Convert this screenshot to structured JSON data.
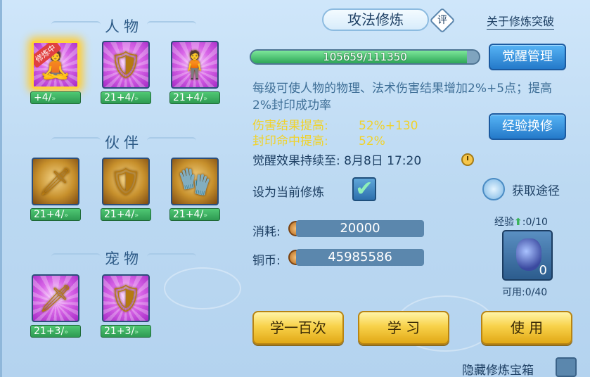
{
  "left": {
    "sections": [
      {
        "title": "人物"
      },
      {
        "title": "伙伴"
      },
      {
        "title": "宠物"
      }
    ],
    "training_tag": "修炼中",
    "skills": [
      {
        "level": "+4/",
        "glyph": "🧘"
      },
      {
        "level": "21+4/",
        "glyph": "🛡"
      },
      {
        "level": "21+4/",
        "glyph": "🧍"
      },
      {
        "level": "21+4/",
        "glyph": "🗡"
      },
      {
        "level": "21+4/",
        "glyph": "🛡"
      },
      {
        "level": "21+4/",
        "glyph": "🧤"
      },
      {
        "level": "21+3/",
        "glyph": "🗡"
      },
      {
        "level": "21+3/",
        "glyph": "🛡"
      }
    ]
  },
  "header": {
    "title": "攻法修炼",
    "rate_label": "评",
    "about_link": "关于修炼突破"
  },
  "progress": {
    "text": "105659/111350",
    "fraction": 0.949
  },
  "buttons": {
    "awaken_manage": "觉醒管理",
    "exp_exchange": "经验换修",
    "learn_hundred": "学一百次",
    "learn": "学 习",
    "use": "使 用"
  },
  "description": "每级可使人物的物理、法术伤害结果增加2%+5点；提高2%封印成功率",
  "stats": [
    {
      "label": "伤害结果提高:",
      "value": "52%+130"
    },
    {
      "label": "封印命中提高:",
      "value": "52%"
    }
  ],
  "awaken_until": "觉醒效果持续至:  8月8日 17:20",
  "set_current_label": "设为当前修炼",
  "set_current_checked": true,
  "obtain_label": "获取途径",
  "cost": {
    "label": "消耗:",
    "value": "20000"
  },
  "copper": {
    "label": "铜币:",
    "value": "45985586"
  },
  "exp": {
    "label": "经验",
    "value": ":0/10"
  },
  "treasure_count": "0",
  "available": "可用:0/40",
  "hide_treasure_label": "隐藏修炼宝箱",
  "colors": {
    "accent_blue": "#2479c9",
    "gold": "#f8d24a",
    "stat_yellow": "#f0d22a",
    "progress_green": "#2da658"
  }
}
